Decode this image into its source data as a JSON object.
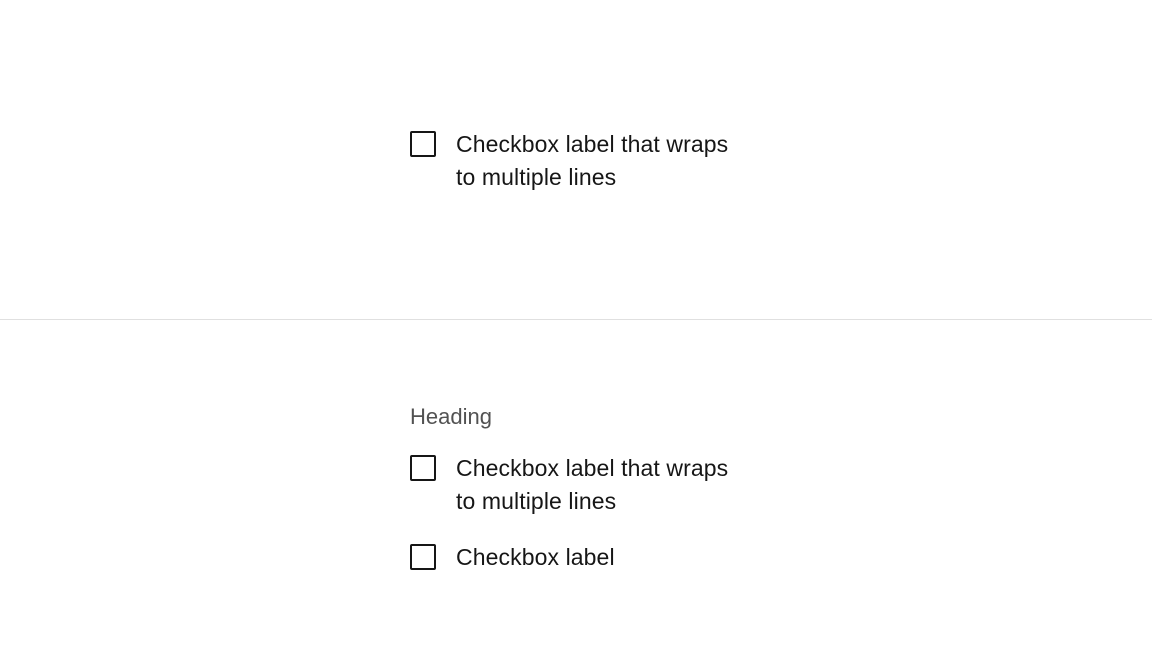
{
  "section_top": {
    "checkbox1": {
      "label": "Checkbox label that wraps to multiple lines"
    }
  },
  "section_bottom": {
    "heading": "Heading",
    "checkbox1": {
      "label": "Checkbox label that wraps to multiple lines"
    },
    "checkbox2": {
      "label": "Checkbox label"
    }
  }
}
